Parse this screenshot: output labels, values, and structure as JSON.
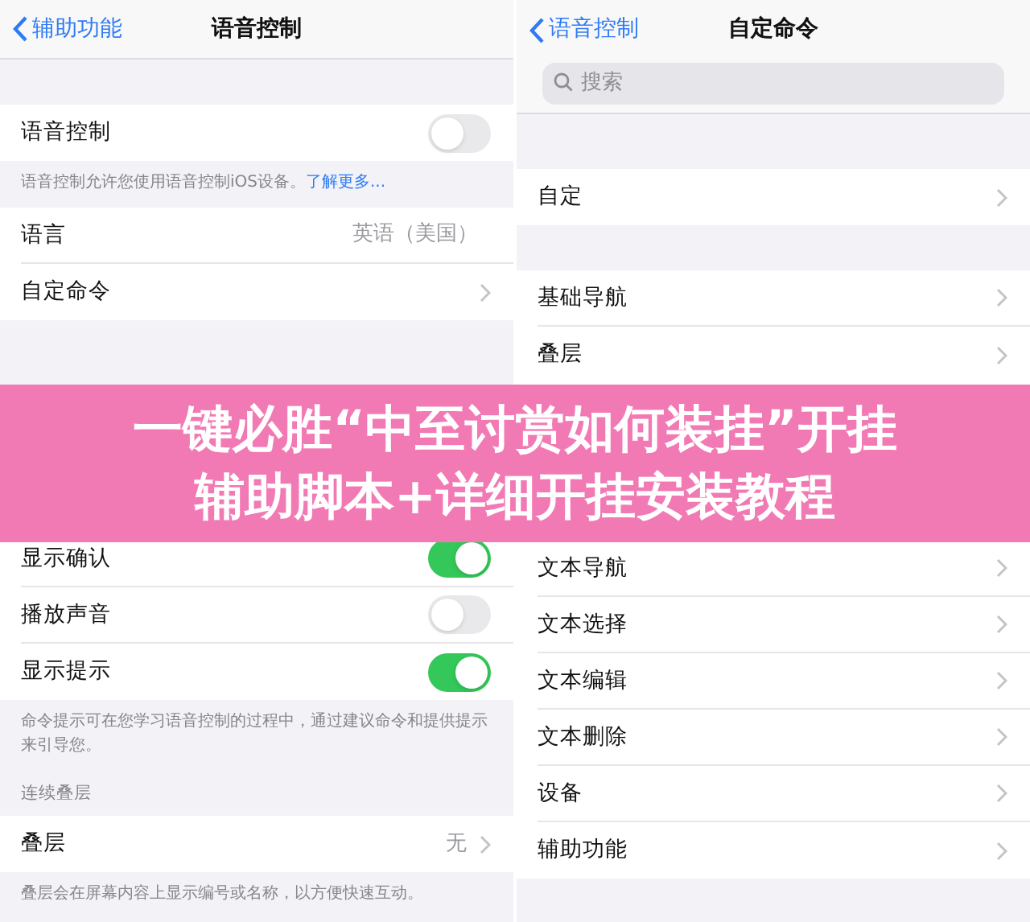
{
  "left": {
    "nav": {
      "back": "辅助功能",
      "title": "语音控制"
    },
    "groups": [
      {
        "rows": [
          {
            "kind": "toggle",
            "label": "语音控制",
            "on": false
          }
        ],
        "footer": "语音控制允许您使用语音控制iOS设备。",
        "footer_link": "了解更多..."
      },
      {
        "rows": [
          {
            "kind": "value",
            "label": "语言",
            "value": "英语（美国）"
          },
          {
            "kind": "link",
            "label": "自定命令"
          }
        ]
      },
      {
        "rows": [
          {
            "kind": "toggle",
            "label": "显示确认",
            "on": true
          },
          {
            "kind": "toggle",
            "label": "播放声音",
            "on": false
          },
          {
            "kind": "toggle",
            "label": "显示提示",
            "on": true
          }
        ],
        "footer": "命令提示可在您学习语音控制的过程中，通过建议命令和提供提示来引导您。"
      },
      {
        "header": "连续叠层",
        "rows": [
          {
            "kind": "link",
            "label": "叠层",
            "value": "无"
          }
        ],
        "footer": "叠层会在屏幕内容上显示编号或名称，以方便快速互动。"
      }
    ]
  },
  "right": {
    "nav": {
      "back": "语音控制",
      "title": "自定命令"
    },
    "search": {
      "placeholder": "搜索"
    },
    "groups": [
      {
        "rows": [
          {
            "kind": "link",
            "label": "自定"
          }
        ]
      },
      {
        "rows": [
          {
            "kind": "link",
            "label": "基础导航"
          },
          {
            "kind": "link",
            "label": "叠层"
          }
        ]
      },
      {
        "rows": [
          {
            "kind": "link",
            "label": "文本导航"
          },
          {
            "kind": "link",
            "label": "文本选择"
          },
          {
            "kind": "link",
            "label": "文本编辑"
          },
          {
            "kind": "link",
            "label": "文本删除"
          },
          {
            "kind": "link",
            "label": "设备"
          },
          {
            "kind": "link",
            "label": "辅助功能"
          }
        ]
      }
    ]
  },
  "banner": {
    "lines": [
      "一键必胜“中至讨赏如何装挂”开挂",
      "辅助脚本+详细开挂安装教程"
    ]
  }
}
